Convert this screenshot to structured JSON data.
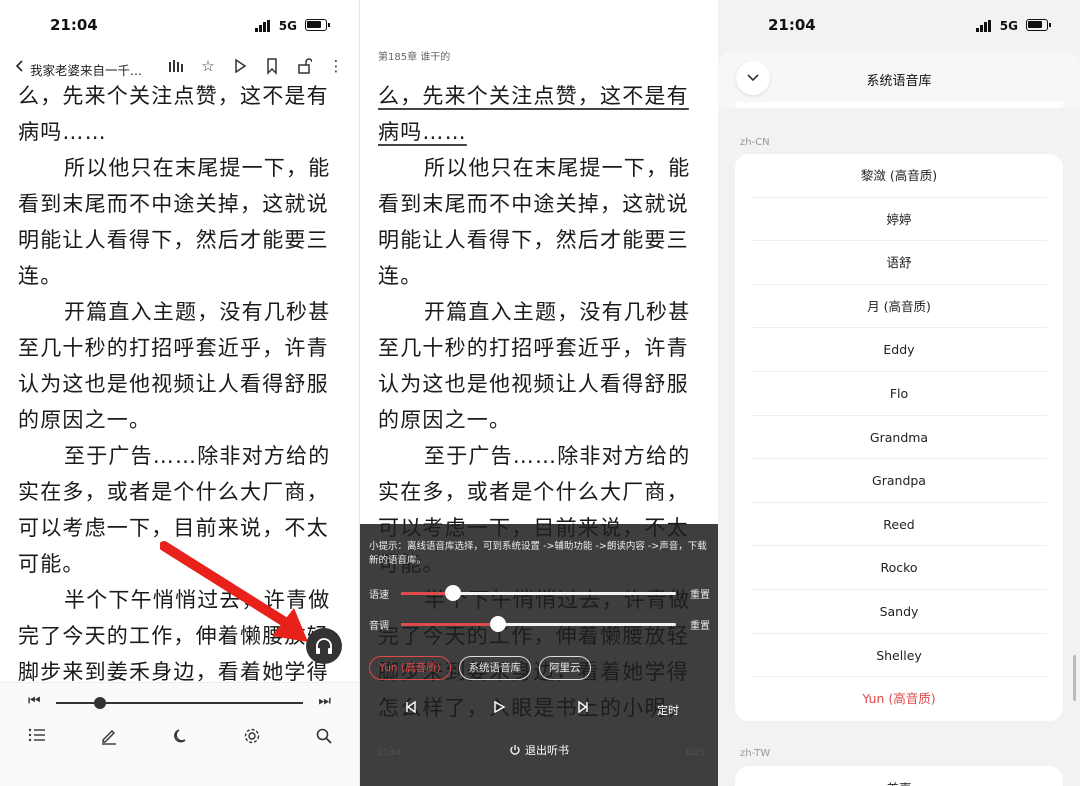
{
  "status": {
    "time": "21:04",
    "network": "5G"
  },
  "reader": {
    "book_title": "我家老婆来自一千...",
    "chapter_title": "第185章 谁干的",
    "paragraphs": [
      {
        "indent": false,
        "text": "么，先来个关注点赞，这不是有病吗……"
      },
      {
        "indent": true,
        "text": "所以他只在末尾提一下，能看到末尾而不中途关掉，这就说明能让人看得下，然后才能要三连。"
      },
      {
        "indent": true,
        "text": "开篇直入主题，没有几秒甚至几十秒的打招呼套近乎，许青认为这也是他视频让人看得舒服的原因之一。"
      },
      {
        "indent": true,
        "text": "至于广告……除非对方给的实在多，或者是个什么大厂商，可以考虑一下，目前来说，不太可能。"
      },
      {
        "indent": true,
        "text": "半个下午悄悄过去，许青做完了今天的工作，伸着懒腰放轻脚步来到姜禾身边，看着她学得怎么样了，入眼是书上的小明，"
      }
    ]
  },
  "player": {
    "progress_fraction": 0.18,
    "tip": "小提示：离线语音库选择，可到系统设置 ->辅助功能 ->朗读内容 ->声音，下载新的语音库。",
    "speed_label": "语速",
    "speed_fraction": 0.19,
    "pitch_label": "音调",
    "pitch_fraction": 0.35,
    "reset_label": "重置",
    "engines": [
      {
        "label": "Yun (高音质)",
        "active": true
      },
      {
        "label": "系统语音库",
        "active": false
      },
      {
        "label": "阿里云",
        "active": false
      }
    ],
    "timer_label": "定时",
    "exit_label": "退出听书",
    "footer_time": "21:04",
    "footer_page": "6/23"
  },
  "voices": {
    "title": "系统语音库",
    "section_cn": "zh-CN",
    "section_tw": "zh-TW",
    "cn_items": [
      {
        "label": "黎潋 (高音质)",
        "selected": false
      },
      {
        "label": "婷婷",
        "selected": false
      },
      {
        "label": "语舒",
        "selected": false
      },
      {
        "label": "月 (高音质)",
        "selected": false
      },
      {
        "label": "Eddy",
        "selected": false
      },
      {
        "label": "Flo",
        "selected": false
      },
      {
        "label": "Grandma",
        "selected": false
      },
      {
        "label": "Grandpa",
        "selected": false
      },
      {
        "label": "Reed",
        "selected": false
      },
      {
        "label": "Rocko",
        "selected": false
      },
      {
        "label": "Sandy",
        "selected": false
      },
      {
        "label": "Shelley",
        "selected": false
      },
      {
        "label": "Yun (高音质)",
        "selected": true
      }
    ],
    "tw_first": "美嘉"
  },
  "colors": {
    "accent": "#e04a4a",
    "arrow": "#e8221b"
  }
}
